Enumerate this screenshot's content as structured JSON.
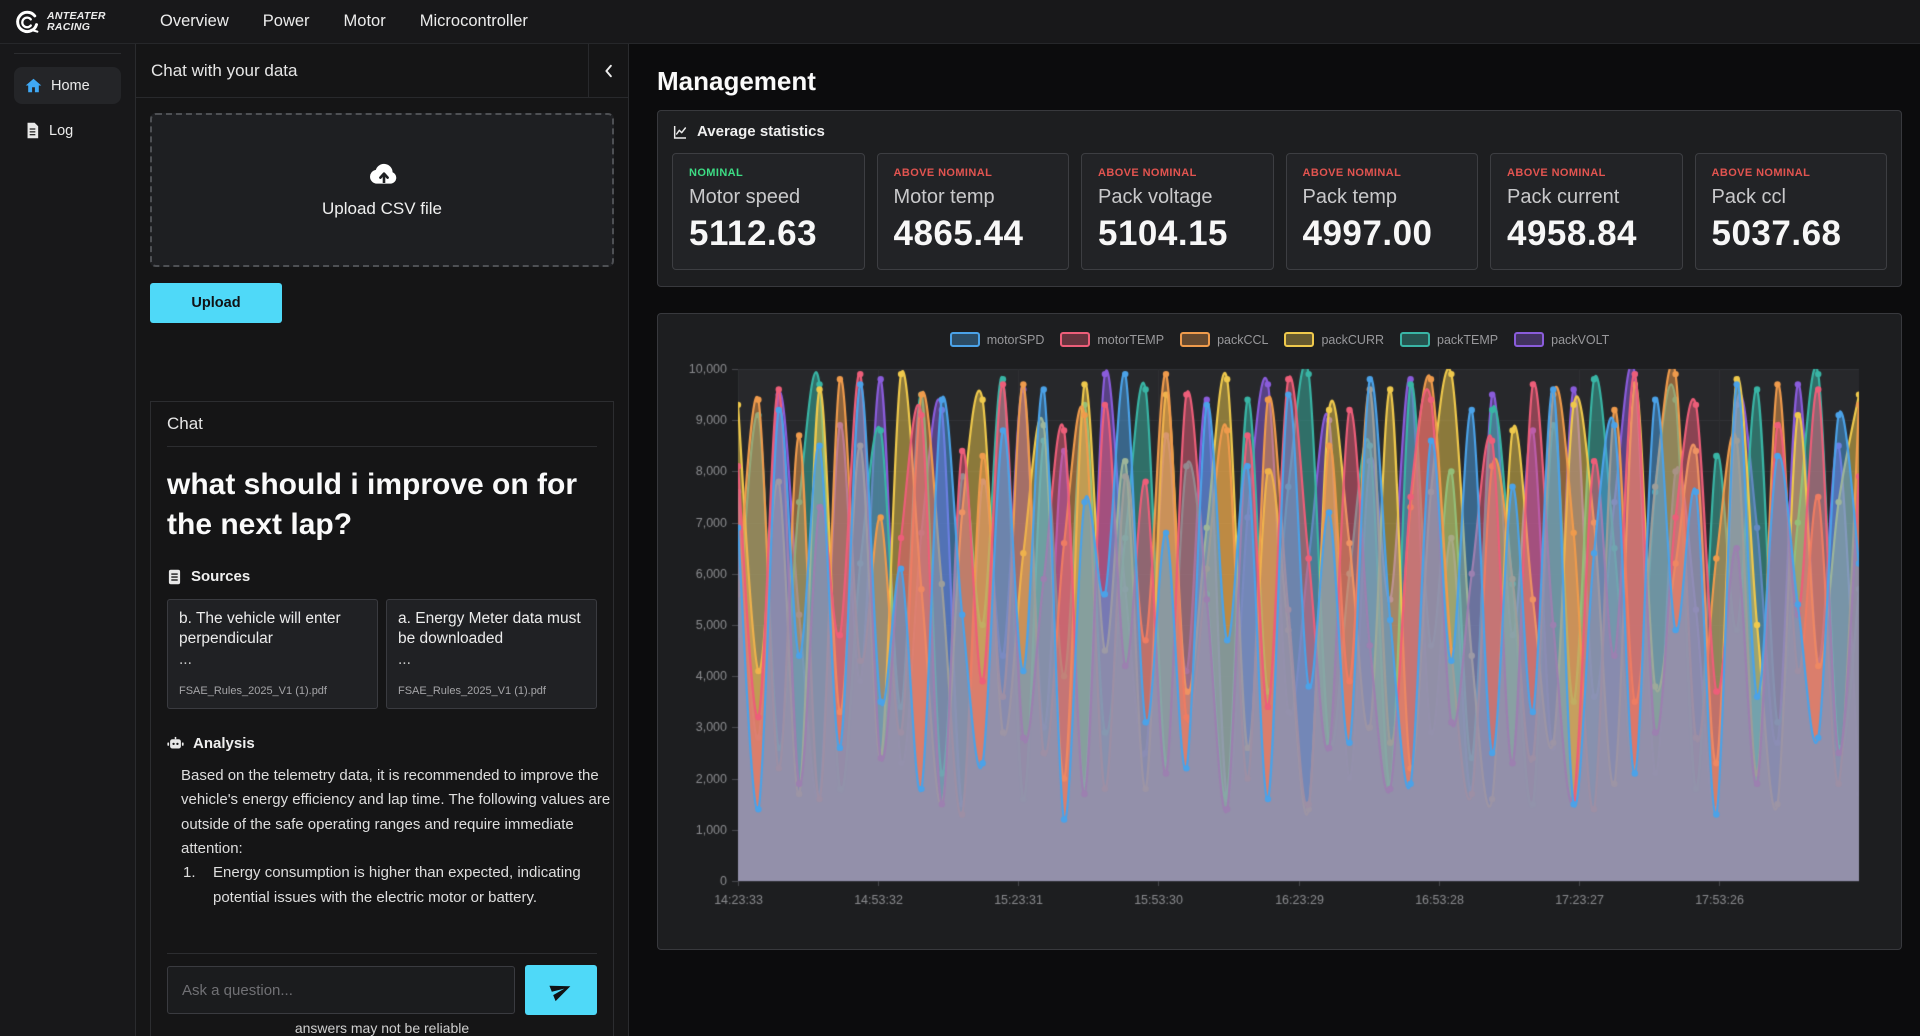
{
  "topbar": {
    "brand_line1": "ANTEATER",
    "brand_line2": "RACING",
    "nav": [
      "Overview",
      "Power",
      "Motor",
      "Microcontroller"
    ]
  },
  "sidebar": {
    "items": [
      {
        "label": "Home",
        "active": true
      },
      {
        "label": "Log",
        "active": false
      }
    ]
  },
  "chat_panel": {
    "header": "Chat with your data",
    "dropzone_label": "Upload CSV file",
    "upload_button": "Upload",
    "chat": {
      "title": "Chat",
      "question": "what should i improve on for the next lap?",
      "sources_label": "Sources",
      "sources": [
        {
          "snippet": "b. The vehicle will enter perpendicular",
          "ellipsis": "...",
          "file": "FSAE_Rules_2025_V1 (1).pdf"
        },
        {
          "snippet": "a. Energy Meter data must be downloaded",
          "ellipsis": "...",
          "file": "FSAE_Rules_2025_V1 (1).pdf"
        }
      ],
      "analysis_label": "Analysis",
      "analysis_intro": "Based on the telemetry data, it is recommended to improve the vehicle's energy efficiency and lap time. The following values are outside of the safe operating ranges and require immediate attention:",
      "analysis_list": [
        {
          "num": "1.",
          "text": "Energy consumption is higher than expected, indicating potential issues with the electric motor or battery."
        }
      ],
      "input_placeholder": "Ask a question...",
      "footer_hint": "answers may not be reliable"
    }
  },
  "main": {
    "title": "Management",
    "stats": {
      "header": "Average statistics",
      "cards": [
        {
          "status": "NOMINAL",
          "label": "Motor speed",
          "value": "5112.63",
          "status_color": "#3DDC84"
        },
        {
          "status": "ABOVE NOMINAL",
          "label": "Motor temp",
          "value": "4865.44",
          "status_color": "#E25450"
        },
        {
          "status": "ABOVE NOMINAL",
          "label": "Pack voltage",
          "value": "5104.15",
          "status_color": "#E25450"
        },
        {
          "status": "ABOVE NOMINAL",
          "label": "Pack temp",
          "value": "4997.00",
          "status_color": "#E25450"
        },
        {
          "status": "ABOVE NOMINAL",
          "label": "Pack current",
          "value": "4958.84",
          "status_color": "#E25450"
        },
        {
          "status": "ABOVE NOMINAL",
          "label": "Pack ccl",
          "value": "5037.68",
          "status_color": "#E25450"
        }
      ]
    }
  },
  "chart_data": {
    "type": "line",
    "title": "",
    "xlabel": "",
    "ylabel": "",
    "ylim": [
      0,
      10000
    ],
    "grid": true,
    "legend_position": "top",
    "fill_opacity": 0.5,
    "point_radius": 3.2,
    "y_tick_labels": [
      "0",
      "1,000",
      "2,000",
      "3,000",
      "4,000",
      "5,000",
      "6,000",
      "7,000",
      "8,000",
      "9,000",
      "10,000"
    ],
    "x_tick_labels": [
      "14:23:33",
      "14:53:32",
      "15:23:31",
      "15:53:30",
      "16:23:29",
      "16:53:28",
      "17:23:27",
      "17:53:26"
    ],
    "series": [
      {
        "name": "motorSPD",
        "color": "#4BA2E8",
        "values": [
          6900,
          1400,
          9200,
          4400,
          8500,
          2600,
          9700,
          3500,
          6100,
          1800,
          9400,
          5200,
          2300,
          8800,
          4100,
          9600,
          1200,
          7400,
          5600,
          9900,
          3100,
          6800,
          2200,
          9300,
          4700,
          8100,
          1600,
          9500,
          3800,
          7200,
          2700,
          9800,
          5100,
          1900,
          8600,
          4300,
          9200,
          2500,
          7700,
          3300,
          9600,
          1500,
          6400,
          8900,
          2100,
          9400,
          4900,
          7600,
          1300,
          9700,
          3600,
          8300,
          5400,
          2800,
          9100,
          6200
        ]
      },
      {
        "name": "motorTEMP",
        "color": "#ED5E79",
        "values": [
          8100,
          3200,
          9600,
          1900,
          7300,
          4800,
          9900,
          2400,
          6700,
          9100,
          1500,
          8400,
          3900,
          9700,
          2800,
          5900,
          8800,
          1700,
          9300,
          4200,
          7800,
          2100,
          9500,
          5500,
          1400,
          8700,
          3400,
          9800,
          6300,
          2600,
          9200,
          4600,
          1800,
          7500,
          9400,
          3100,
          6000,
          8600,
          2300,
          9700,
          5000,
          1600,
          8200,
          4400,
          9900,
          2900,
          7100,
          9300,
          3700,
          6500,
          1900,
          8900,
          5200,
          9600,
          2500,
          7900
        ]
      },
      {
        "name": "packCCL",
        "color": "#EF9B4C",
        "values": [
          5600,
          9400,
          2200,
          8700,
          1600,
          9800,
          4300,
          7100,
          2900,
          9500,
          5800,
          1300,
          8300,
          3600,
          9700,
          2500,
          6600,
          9100,
          1800,
          7900,
          4700,
          9900,
          3200,
          6100,
          8800,
          2000,
          9400,
          5300,
          1500,
          8500,
          3900,
          9600,
          2700,
          7300,
          9800,
          4500,
          1700,
          8100,
          5900,
          2400,
          9500,
          6800,
          1400,
          9200,
          3500,
          7700,
          9900,
          2800,
          6300,
          8600,
          2100,
          9700,
          4100,
          7500,
          1900,
          9300
        ]
      },
      {
        "name": "packCURR",
        "color": "#EFC94C",
        "values": [
          9300,
          4100,
          7800,
          1700,
          9600,
          3300,
          8500,
          2400,
          9900,
          5700,
          1500,
          7200,
          9400,
          2900,
          6400,
          8900,
          2000,
          9700,
          4500,
          8200,
          1800,
          9500,
          3700,
          6900,
          9800,
          2600,
          8000,
          4900,
          1400,
          9200,
          6600,
          3000,
          9600,
          2200,
          7600,
          9900,
          4400,
          1600,
          8800,
          5500,
          2700,
          9300,
          7000,
          1900,
          9700,
          3800,
          6200,
          8400,
          2300,
          9800,
          5000,
          1500,
          9100,
          4200,
          7400,
          9500
        ]
      },
      {
        "name": "packTEMP",
        "color": "#39B5A5",
        "values": [
          4800,
          9100,
          2600,
          7400,
          9700,
          1800,
          6200,
          8800,
          3400,
          9500,
          2100,
          7900,
          5000,
          9800,
          1600,
          8600,
          4000,
          9300,
          2900,
          6700,
          9600,
          2300,
          8100,
          5600,
          1700,
          9400,
          3700,
          7700,
          9900,
          2700,
          6000,
          8500,
          1900,
          9700,
          4600,
          8000,
          2400,
          9200,
          5800,
          1500,
          8900,
          3500,
          9800,
          6500,
          2200,
          7600,
          9400,
          1800,
          8300,
          4900,
          9600,
          3100,
          7000,
          9900,
          2600,
          5700
        ]
      },
      {
        "name": "packVOLT",
        "color": "#8A5CDB",
        "values": [
          7600,
          2800,
          9500,
          5200,
          1700,
          8900,
          3900,
          9800,
          2300,
          6800,
          9200,
          1500,
          7800,
          4400,
          9600,
          3000,
          8400,
          1900,
          9900,
          5700,
          2500,
          8700,
          4100,
          9400,
          1600,
          7100,
          9700,
          3300,
          6300,
          9000,
          2000,
          8200,
          5500,
          9800,
          2900,
          6700,
          1800,
          9500,
          4800,
          8800,
          2600,
          9600,
          3600,
          7400,
          9900,
          2100,
          8000,
          5300,
          1400,
          9300,
          6900,
          2700,
          9700,
          4300,
          8500,
          1700
        ]
      }
    ]
  }
}
